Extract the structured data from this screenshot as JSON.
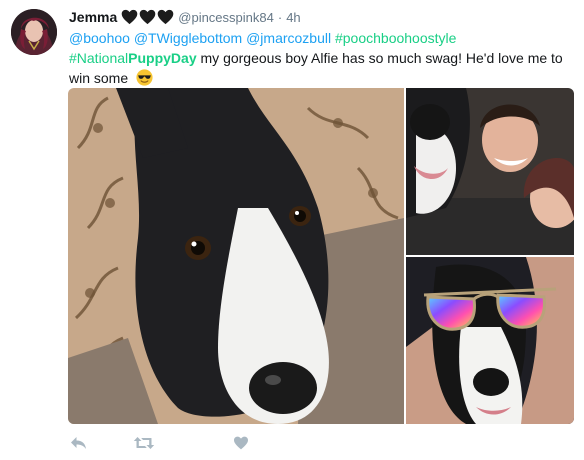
{
  "tweet": {
    "author_name": "Jemma",
    "handle": "@pincesspink84",
    "time_separator": "·",
    "time": "4h",
    "mentions": [
      "@boohoo",
      "@TWigglebottom",
      "@jmarcozbull"
    ],
    "hashtag_poochboohoo": "#poochboohoostyle",
    "hashtag_npd_prefix": "#National",
    "hashtag_npd_bold": "PuppyDay",
    "body_text": " my gorgeous boy Alfie has so much swag! He'd love me to win some",
    "emoji": "sunglasses-face"
  },
  "photos": [
    {
      "subject": "black and white dog looking up on rug"
    },
    {
      "subject": "dog nose close-up with smiling people"
    },
    {
      "subject": "dog wearing rainbow mirrored sunglasses"
    }
  ],
  "actions": {
    "reply_icon": "reply-icon",
    "retweet_icon": "retweet-icon",
    "like_icon": "heart-icon"
  },
  "colors": {
    "link": "#1da1f2",
    "hashtag": "#19cf86",
    "action_icon": "#aab8c2",
    "secondary_text": "#657786"
  }
}
